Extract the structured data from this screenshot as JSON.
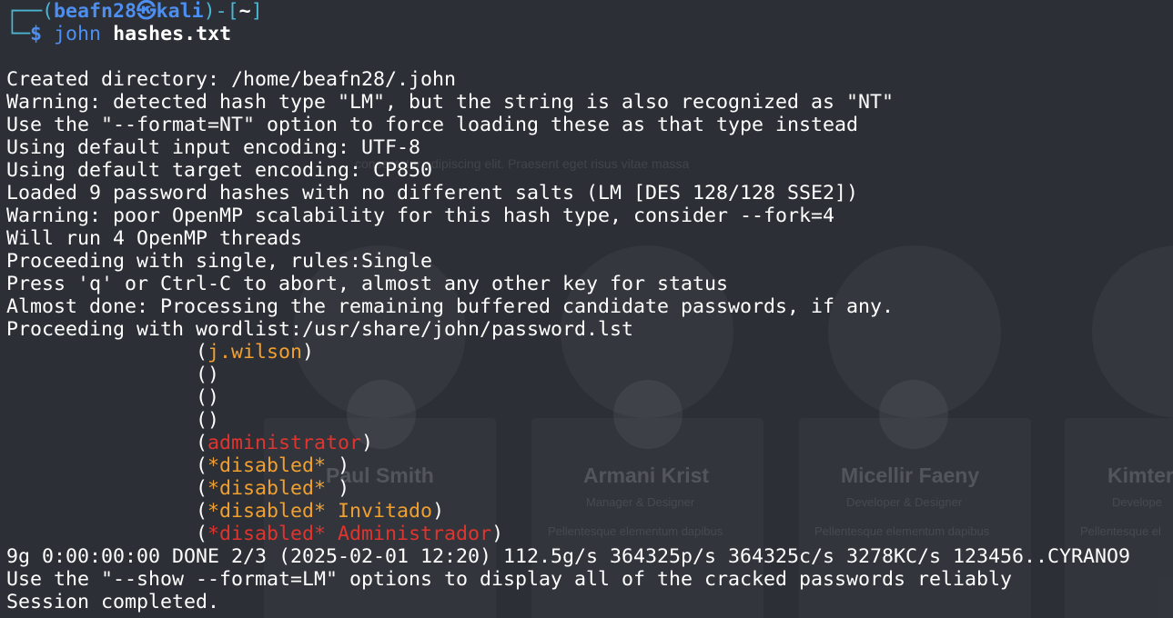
{
  "prompt": {
    "frame_open": "┌──(",
    "user": "beafn28",
    "at_symbol": "㉿",
    "host": "kali",
    "frame_mid": ")-[",
    "path": "~",
    "frame_close": "]",
    "frame_lower": "└─",
    "dollar": "$ ",
    "command": "john",
    "argument": "hashes.txt"
  },
  "output": {
    "created": "Created directory: /home/beafn28/.john",
    "warn_hash": "Warning: detected hash type \"LM\", but the string is also recognized as \"NT\"",
    "use_format": "Use the \"--format=NT\" option to force loading these as that type instead",
    "input_enc": "Using default input encoding: UTF-8",
    "target_enc": "Using default target encoding: CP850",
    "loaded": "Loaded 9 password hashes with no different salts (LM [DES 128/128 SSE2])",
    "warn_openmp": "Warning: poor OpenMP scalability for this hash type, consider --fork=4",
    "threads": "Will run 4 OpenMP threads",
    "single": "Proceeding with single, rules:Single",
    "press": "Press 'q' or Ctrl-C to abort, almost any other key for status",
    "almost": "Almost done: Processing the remaining buffered candidate passwords, if any.",
    "wordlist": "Proceeding with wordlist:/usr/share/john/password.lst",
    "cracked": [
      {
        "indent": "                ",
        "open": "(",
        "value": "j.wilson",
        "value_color": "orange",
        "extra": "",
        "extra_color": "orange",
        "close": ")"
      },
      {
        "indent": "                ",
        "open": "(",
        "value": "",
        "value_color": "orange",
        "extra": "",
        "extra_color": "orange",
        "close": ")"
      },
      {
        "indent": "                ",
        "open": "(",
        "value": "",
        "value_color": "orange",
        "extra": "",
        "extra_color": "orange",
        "close": ")"
      },
      {
        "indent": "                ",
        "open": "(",
        "value": "",
        "value_color": "orange",
        "extra": "",
        "extra_color": "orange",
        "close": ")"
      },
      {
        "indent": "                ",
        "open": "(",
        "value": "administrator",
        "value_color": "red",
        "extra": "",
        "extra_color": "red",
        "close": ")"
      },
      {
        "indent": "                ",
        "open": "(",
        "value": "*disabled*",
        "value_color": "orange",
        "extra": " ",
        "extra_color": "orange",
        "close": ")"
      },
      {
        "indent": "                ",
        "open": "(",
        "value": "*disabled*",
        "value_color": "orange",
        "extra": " ",
        "extra_color": "orange",
        "close": ")"
      },
      {
        "indent": "                ",
        "open": "(",
        "value": "*disabled*",
        "value_color": "orange",
        "extra": " Invitado",
        "extra_color": "orange",
        "close": ")"
      },
      {
        "indent": "                ",
        "open": "(",
        "value": "*disabled*",
        "value_color": "red",
        "extra": " Administrador",
        "extra_color": "red",
        "close": ")"
      }
    ],
    "summary": "9g 0:00:00:00 DONE 2/3 (2025-02-01 12:20) 112.5g/s 364325p/s 364325c/s 3278KC/s 123456..CYRANO9",
    "show_hint": "Use the \"--show --format=LM\" options to display all of the cracked passwords reliably",
    "session": "Session completed."
  },
  "background": {
    "lorem": "consectetur adipiscing elit. Praesent eget risus vitae massa",
    "cards": [
      {
        "name": "Paul Smith",
        "role": "",
        "desc": ""
      },
      {
        "name": "Armani Krist",
        "role": "Manager & Designer",
        "desc": "Pellentesque elementum dapibus"
      },
      {
        "name": "Micellir Faeny",
        "role": "Developer & Designer",
        "desc": "Pellentesque elementum dapibus"
      },
      {
        "name": "Kimter",
        "role": "Develope",
        "desc": "Pellentesque el"
      }
    ]
  },
  "colors": {
    "background": "#2c2f36",
    "frame": "#4bb6d4",
    "user": "#4d8ff0",
    "orange": "#f0a030",
    "red": "#e0342e",
    "text": "#ffffff"
  }
}
